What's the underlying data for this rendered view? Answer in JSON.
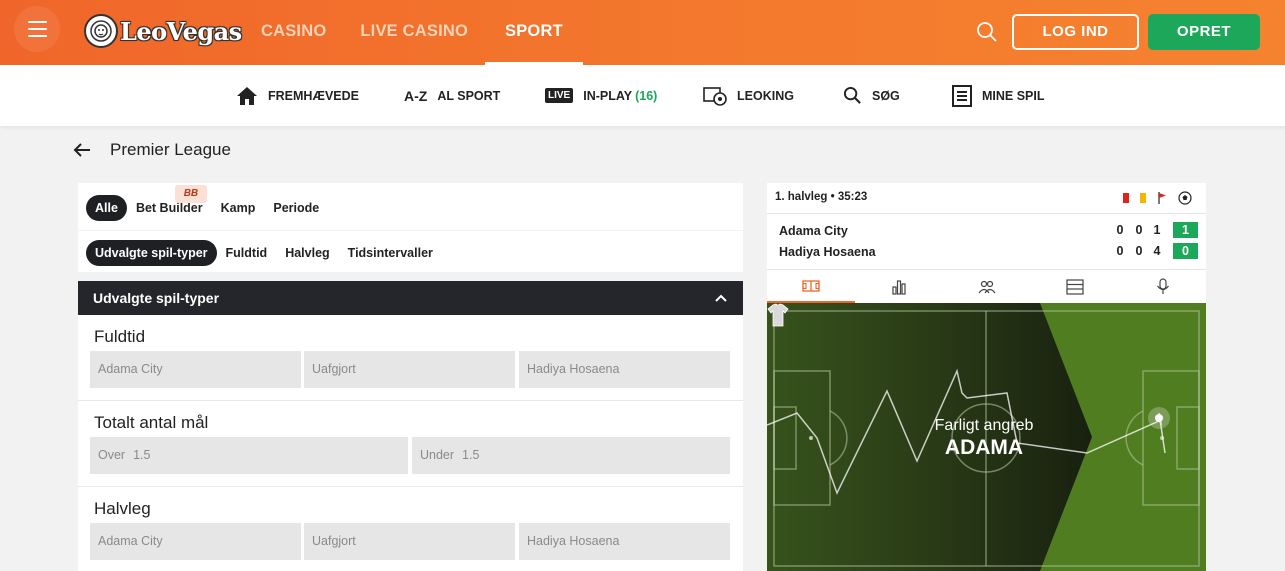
{
  "header": {
    "brand": "LeoVegas",
    "nav": [
      {
        "label": "CASINO",
        "active": false
      },
      {
        "label": "LIVE CASINO",
        "active": false
      },
      {
        "label": "SPORT",
        "active": true
      }
    ],
    "login_label": "LOG IND",
    "register_label": "OPRET"
  },
  "subnav": {
    "featured": "FREMHÆVEDE",
    "az_icon": "A-Z",
    "all_sport": "AL SPORT",
    "live_badge": "LIVE",
    "inplay": "IN-PLAY",
    "inplay_count": "(16)",
    "leoking": "LEOKING",
    "search": "SØG",
    "mybets": "MINE SPIL"
  },
  "page": {
    "title": "Premier League"
  },
  "filters": {
    "row1": [
      "Alle",
      "Bet Builder",
      "Kamp",
      "Periode"
    ],
    "bb_badge": "BB",
    "row2": [
      "Udvalgte spil-typer",
      "Fuldtid",
      "Halvleg",
      "Tidsintervaller"
    ]
  },
  "section": {
    "title": "Udvalgte spil-typer"
  },
  "markets": [
    {
      "title": "Fuldtid",
      "odds": [
        {
          "label": "Adama City",
          "value": ""
        },
        {
          "label": "Uafgjort",
          "value": ""
        },
        {
          "label": "Hadiya Hosaena",
          "value": ""
        }
      ]
    },
    {
      "title": "Totalt antal mål",
      "odds": [
        {
          "label": "Over",
          "value": "1.5"
        },
        {
          "label": "Under",
          "value": "1.5"
        }
      ]
    },
    {
      "title": "Halvleg",
      "odds": [
        {
          "label": "Adama City",
          "value": ""
        },
        {
          "label": "Uafgjort",
          "value": ""
        },
        {
          "label": "Hadiya Hosaena",
          "value": ""
        }
      ]
    }
  ],
  "match": {
    "time": "1. halvleg • 35:23",
    "teams": [
      {
        "name": "Adama City",
        "red": "0",
        "yellow": "0",
        "corners": "1",
        "goals": "1"
      },
      {
        "name": "Hadiya Hosaena",
        "red": "0",
        "yellow": "0",
        "corners": "4",
        "goals": "0"
      }
    ],
    "event_label": "Farligt angreb",
    "event_team": "ADAMA",
    "colors": {
      "accent": "#f0662a",
      "green": "#1ca75a",
      "dark": "#25262b"
    }
  }
}
